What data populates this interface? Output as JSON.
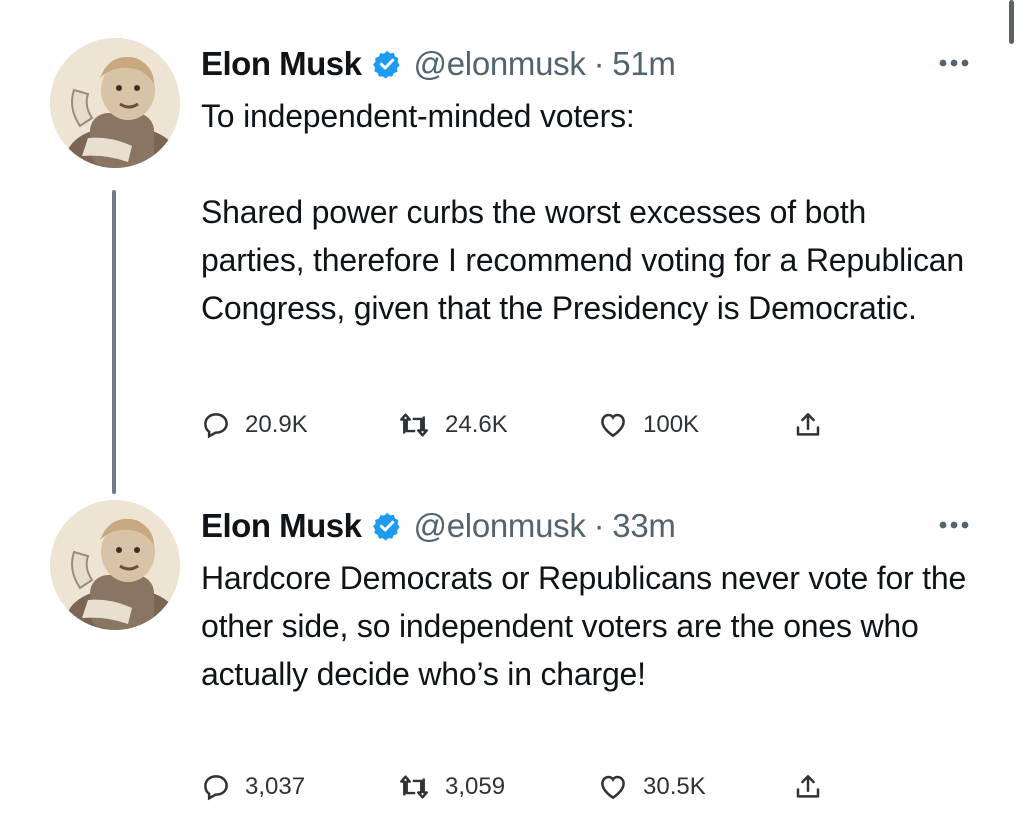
{
  "tweets": [
    {
      "author": "Elon Musk",
      "handle": "@elonmusk",
      "separator": "·",
      "time": "51m",
      "text": "To independent-minded voters:\n\nShared power curbs the worst excesses of both parties, therefore I recommend voting for a Republican Congress, given that the Presidency is Democratic.",
      "replies": "20.9K",
      "retweets": "24.6K",
      "likes": "100K"
    },
    {
      "author": "Elon Musk",
      "handle": "@elonmusk",
      "separator": "·",
      "time": "33m",
      "text": "Hardcore Democrats or Republicans never vote for the other side, so independent voters are the ones who actually decide who’s in charge!",
      "replies": "3,037",
      "retweets": "3,059",
      "likes": "30.5K"
    }
  ],
  "colors": {
    "verified": "#1d9bf0",
    "muted_text": "#536471",
    "thread_line": "#6f7a86"
  },
  "icons": {
    "verified": "verified-badge-icon",
    "more": "more-horizontal-icon",
    "reply": "reply-icon",
    "retweet": "retweet-icon",
    "like": "heart-icon",
    "share": "share-icon"
  }
}
